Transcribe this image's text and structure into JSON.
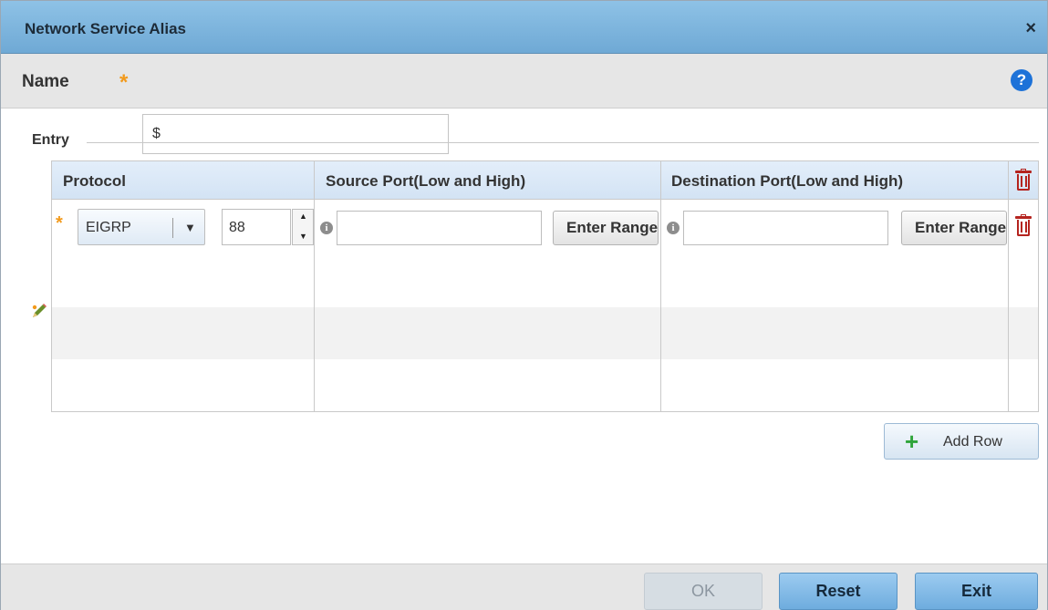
{
  "dialog": {
    "title": "Network Service Alias",
    "close_icon": "close-icon"
  },
  "name_field": {
    "label": "Name",
    "required_marker": "*",
    "value": "$"
  },
  "help_icon": "?",
  "entry": {
    "label": "Entry",
    "columns": [
      "Protocol",
      "Source Port(Low and High)",
      "Destination Port(Low and High)"
    ],
    "rows": [
      {
        "required_marker": "*",
        "protocol": "EIGRP",
        "protocol_number": "88",
        "source_port": "",
        "source_range_button": "Enter Range",
        "destination_port": "",
        "destination_range_button": "Enter Range"
      }
    ]
  },
  "buttons": {
    "add_row": "Add Row",
    "ok": "OK",
    "reset": "Reset",
    "exit": "Exit"
  },
  "colors": {
    "titlebar": "#7bb5de",
    "required": "#f29a1c",
    "delete_icon": "#b5241f",
    "add_icon": "#2ea43a",
    "primary_button": "#7fb8e4"
  }
}
